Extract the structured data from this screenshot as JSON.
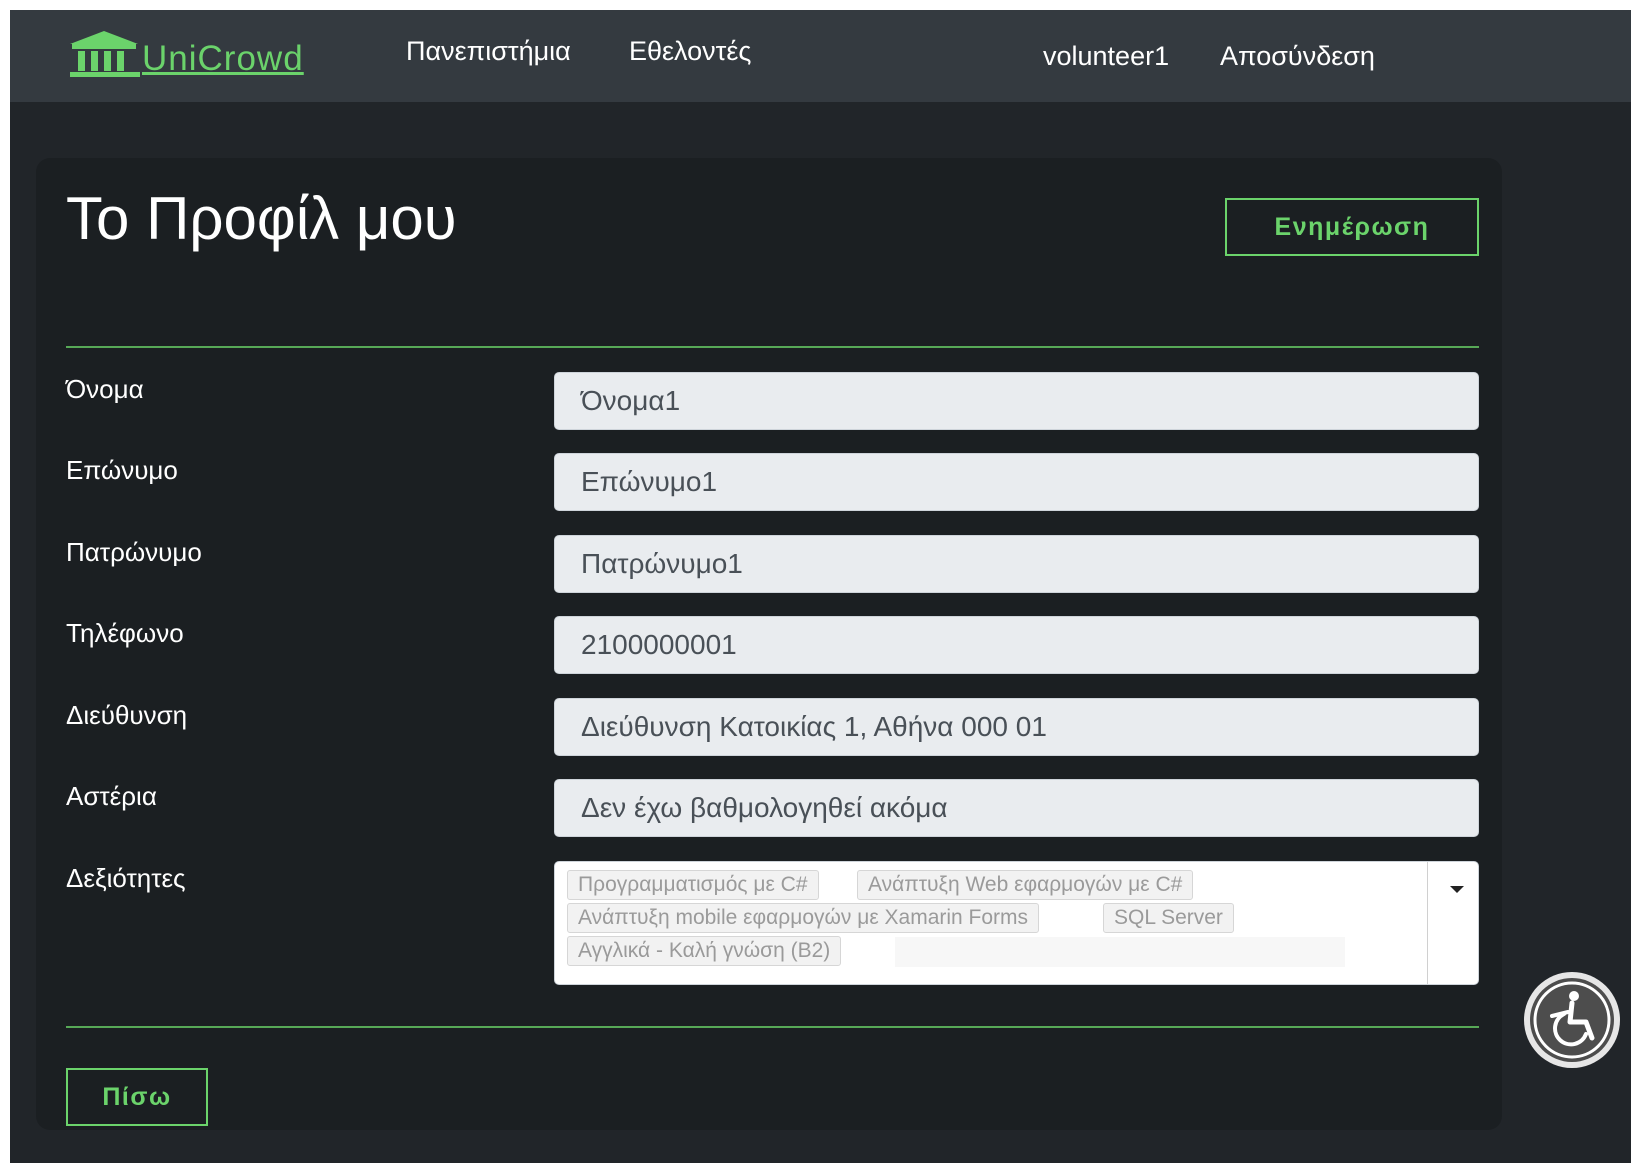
{
  "navbar": {
    "brand": "UniCrowd",
    "links": [
      "Πανεπιστήμια",
      "Εθελοντές"
    ],
    "user": "volunteer1",
    "logout": "Αποσύνδεση",
    "accent_color": "#6bd36b"
  },
  "profile": {
    "title": "Το Προφίλ μου",
    "update_button": "Ενημέρωση",
    "back_button": "Πίσω",
    "fields": [
      {
        "label": "Όνομα",
        "value": "Όνομα1"
      },
      {
        "label": "Επώνυμο",
        "value": "Επώνυμο1"
      },
      {
        "label": "Πατρώνυμο",
        "value": "Πατρώνυμο1"
      },
      {
        "label": "Τηλέφωνο",
        "value": "2100000001"
      },
      {
        "label": "Διεύθυνση",
        "value": "Διεύθυνση Κατοικίας 1, Αθήνα 000 01"
      },
      {
        "label": "Αστέρια",
        "value": "Δεν έχω βαθμολογηθεί ακόμα"
      }
    ],
    "skills_label": "Δεξιότητες",
    "skills": [
      "Προγραμματισμός με C#",
      "Ανάπτυξη Web εφαρμογών με C#",
      "Ανάπτυξη mobile εφαρμογών με Xamarin Forms",
      "SQL Server",
      "Αγγλικά - Καλή γνώση (B2)"
    ]
  },
  "icons": {
    "brand": "university-building-icon",
    "skills_dropdown": "caret-down-icon",
    "accessibility": "wheelchair-accessibility-icon"
  }
}
